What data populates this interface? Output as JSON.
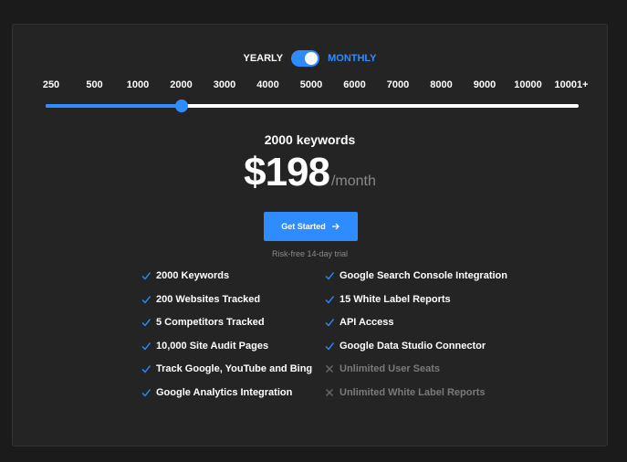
{
  "toggle": {
    "yearly_label": "YEARLY",
    "monthly_label": "MONTHLY",
    "selected": "monthly"
  },
  "slider": {
    "ticks": [
      "250",
      "500",
      "1000",
      "2000",
      "3000",
      "4000",
      "5000",
      "6000",
      "7000",
      "8000",
      "9000",
      "10000",
      "10001+"
    ],
    "selected_index": 3
  },
  "plan": {
    "keywords_label": "2000 keywords",
    "price": "$198",
    "period": "/month",
    "cta_label": "Get Started",
    "cta_icon": "arrow-right-icon",
    "trial_text": "Risk-free 14-day trial"
  },
  "features": {
    "left": [
      {
        "label": "2000 Keywords",
        "included": true
      },
      {
        "label": "200 Websites Tracked",
        "included": true
      },
      {
        "label": "5 Competitors Tracked",
        "included": true
      },
      {
        "label": "10,000 Site Audit Pages",
        "included": true
      },
      {
        "label": "Track Google, YouTube and Bing",
        "included": true
      },
      {
        "label": "Google Analytics Integration",
        "included": true
      }
    ],
    "right": [
      {
        "label": "Google Search Console Integration",
        "included": true
      },
      {
        "label": "15 White Label Reports",
        "included": true
      },
      {
        "label": "API Access",
        "included": true
      },
      {
        "label": "Google Data Studio Connector",
        "included": true
      },
      {
        "label": "Unlimited User Seats",
        "included": false
      },
      {
        "label": "Unlimited White Label Reports",
        "included": false
      }
    ]
  },
  "colors": {
    "accent": "#2f8cff",
    "muted": "#8a8a8a",
    "card": "#242424",
    "background": "#1b1b1b"
  }
}
